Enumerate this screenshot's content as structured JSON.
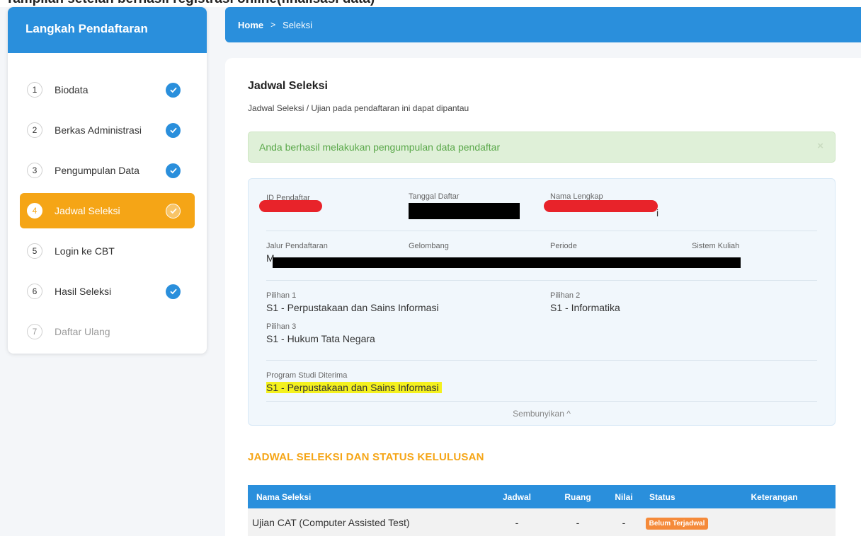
{
  "top_caption": "Tampilan setelah berhasil registrasi online(finalisasi data)",
  "sidebar": {
    "title": "Langkah Pendaftaran",
    "steps": [
      {
        "num": "1",
        "label": "Biodata",
        "done": true
      },
      {
        "num": "2",
        "label": "Berkas Administrasi",
        "done": true
      },
      {
        "num": "3",
        "label": "Pengumpulan Data",
        "done": true
      },
      {
        "num": "4",
        "label": "Jadwal Seleksi",
        "done": true,
        "active": true
      },
      {
        "num": "5",
        "label": "Login ke CBT",
        "done": false
      },
      {
        "num": "6",
        "label": "Hasil Seleksi",
        "done": true
      },
      {
        "num": "7",
        "label": "Daftar Ulang",
        "done": false,
        "disabled": true
      }
    ]
  },
  "breadcrumb": {
    "home": "Home",
    "separator": ">",
    "current": "Seleksi"
  },
  "main": {
    "title": "Jadwal Seleksi",
    "subtitle": "Jadwal Seleksi / Ujian pada pendaftaran ini dapat dipantau",
    "alert": "Anda berhasil melakukan pengumpulan data pendaftar",
    "alert_close": "×"
  },
  "info": {
    "id_label": "ID Pendaftar",
    "tanggal_label": "Tanggal Daftar",
    "nama_label": "Nama Lengkap",
    "nama_tail": "i",
    "jalur_label": "Jalur Pendaftaran",
    "jalur_value_prefix": "M",
    "gelombang_label": "Gelombang",
    "periode_label": "Periode",
    "sistem_label": "Sistem Kuliah",
    "pilihan1_label": "Pilihan 1",
    "pilihan1_value": "S1 - Perpustakaan dan Sains Informasi",
    "pilihan2_label": "Pilihan 2",
    "pilihan2_value": "S1 - Informatika",
    "pilihan3_label": "Pilihan 3",
    "pilihan3_value": "S1 - Hukum Tata Negara",
    "diterima_label": "Program Studi Diterima",
    "diterima_value": "S1 - Perpustakaan dan Sains Informasi",
    "toggle": "Sembunyikan ^"
  },
  "schedule": {
    "title": "JADWAL SELEKSI DAN STATUS KELULUSAN",
    "columns": [
      "Nama Seleksi",
      "Jadwal",
      "Ruang",
      "Nilai",
      "Status",
      "Keterangan"
    ],
    "rows": [
      {
        "nama": "Ujian CAT (Computer Assisted Test)",
        "jadwal": "-",
        "ruang": "-",
        "nilai": "-",
        "status": "Belum Terjadwal",
        "keterangan": ""
      }
    ]
  },
  "colors": {
    "primary": "#2a8fdc",
    "accent": "#f5a516",
    "alert_bg": "#dff0d8",
    "redaction_red": "#e8232a",
    "highlight": "#f4f11e"
  }
}
